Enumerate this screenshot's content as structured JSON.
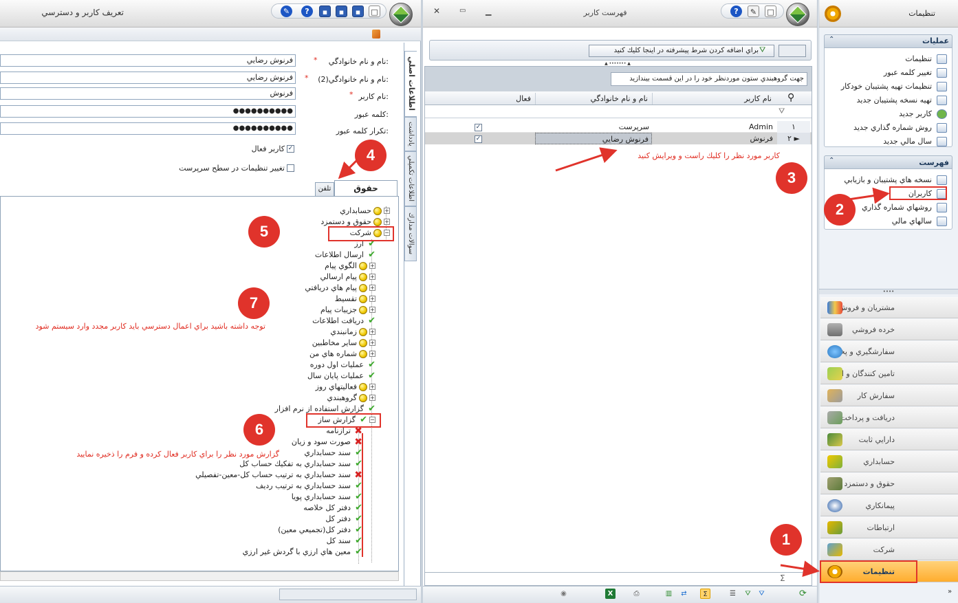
{
  "settings_panel": {
    "title": "تنظيمات",
    "operations_header": "عمليات",
    "operations": [
      "تنظيمات",
      "تغيير كلمه عبور",
      "تنظيمات تهيه پشتيبان خودكار",
      "تهيه نسخه پشتيبان جديد",
      "كاربر جديد",
      "روش شماره گذاري جديد",
      "سال مالي جديد"
    ],
    "list_header": "فهرست",
    "list_items": [
      "نسخه هاي پشتيبان و بازيابي",
      "كاربران",
      "روشهاي شماره گذاري",
      "سالهاي مالي"
    ],
    "nav_modules": [
      "مشتريان و فروش",
      "خرده فروشي",
      "سفارشگيري و پخش",
      "تامين كنندگان و انبار",
      "سفارش كار",
      "دريافت و پرداخت",
      "دارايي ثابت",
      "حسابداري",
      "حقوق و دستمزد",
      "پيمانكاري",
      "ارتباطات",
      "شركت",
      "تنظيمات"
    ],
    "selected_module": "تنظيمات"
  },
  "user_list": {
    "title": "فهرست كاربر",
    "filter_button": "براي اضافه كردن شرط پيشرفته در اينجا كليك كنيد",
    "group_hint": "جهت گروهبندي ستون موردنظر خود را در اين قسمت بيندازيد",
    "columns": [
      "نام كاربر",
      "نام و نام خانوادگي",
      "فعال"
    ],
    "rows": [
      {
        "index": "١",
        "username": "Admin",
        "fullname": "سرپرست",
        "active": true
      },
      {
        "index": "٢",
        "username": "فرنوش",
        "fullname": "فرنوش رضايي",
        "active": true
      }
    ],
    "sigma": "Σ"
  },
  "user_form": {
    "title": "تعريف كاربر و دسترسي",
    "labels": {
      "name": "نام و نام خانوادگي:",
      "name2": "نام و نام خانوادگي(2):",
      "username": "نام كاربر:",
      "password": "كلمه عبور:",
      "password_repeat": "تكرار كلمه عبور:",
      "active": "كاربر فعال",
      "change_settings": "تغيير تنظيمات در سطح سرپرست"
    },
    "values": {
      "name": "فرنوش رضايي",
      "name2": "فرنوش رضايي",
      "username": "فرنوش",
      "password": "●●●●●●●●●●",
      "password_repeat": "●●●●●●●●●●"
    },
    "vertical_tabs": [
      "اطلاعات اصلي",
      "يادداشت",
      "اطلاعات تكميلي",
      "سوالات مدارك"
    ],
    "tabs": [
      "حقوق دسترسي",
      "تلفن"
    ],
    "tree": [
      {
        "label": "حسابداري",
        "icon": "yellow",
        "exp": "+"
      },
      {
        "label": "حقوق و دستمزد",
        "icon": "yellow",
        "exp": "+"
      },
      {
        "label": "شركت",
        "icon": "yellow",
        "exp": "-"
      },
      {
        "label": "ارز",
        "icon": "ok",
        "exp": ""
      },
      {
        "label": "ارسال اطلاعات",
        "icon": "ok",
        "exp": ""
      },
      {
        "label": "الگوي پيام",
        "icon": "yellow",
        "exp": "+"
      },
      {
        "label": "پيام ارسالي",
        "icon": "yellow",
        "exp": "+"
      },
      {
        "label": "پيام هاي دريافتي",
        "icon": "yellow",
        "exp": "+"
      },
      {
        "label": "تقسيط",
        "icon": "yellow",
        "exp": "+"
      },
      {
        "label": "جزييات پيام",
        "icon": "yellow",
        "exp": "+"
      },
      {
        "label": "دريافت اطلاعات",
        "icon": "ok",
        "exp": ""
      },
      {
        "label": "زمانبندي",
        "icon": "yellow",
        "exp": "+"
      },
      {
        "label": "ساير مخاطبين",
        "icon": "yellow",
        "exp": "+"
      },
      {
        "label": "شماره هاي من",
        "icon": "yellow",
        "exp": "+"
      },
      {
        "label": "عمليات اول دوره",
        "icon": "ok",
        "exp": ""
      },
      {
        "label": "عمليات پايان سال",
        "icon": "ok",
        "exp": ""
      },
      {
        "label": "فعاليتهاي روز",
        "icon": "yellow",
        "exp": "+"
      },
      {
        "label": "گروهبندي",
        "icon": "yellow",
        "exp": "+"
      },
      {
        "label": "گزارش استفاده از نرم افزار",
        "icon": "ok",
        "exp": ""
      },
      {
        "label": "گزارش ساز",
        "icon": "ok",
        "exp": "-"
      },
      {
        "label": "ترازنامه",
        "icon": "x",
        "exp": ""
      },
      {
        "label": "صورت سود و زيان",
        "icon": "x",
        "exp": ""
      },
      {
        "label": "سند حسابداري",
        "icon": "ok",
        "exp": ""
      },
      {
        "label": "سند حسابداري به تفكيك حساب كل",
        "icon": "ok",
        "exp": ""
      },
      {
        "label": "سند حسابداري به ترتيب حساب كل-معين-تفصيلي",
        "icon": "x",
        "exp": ""
      },
      {
        "label": "سند حسابداري به ترتيب رديف",
        "icon": "ok",
        "exp": ""
      },
      {
        "label": "سند حسابداري پويا",
        "icon": "ok",
        "exp": ""
      },
      {
        "label": "دفتر كل خلاصه",
        "icon": "ok",
        "exp": ""
      },
      {
        "label": "دفتر كل",
        "icon": "ok",
        "exp": ""
      },
      {
        "label": "دفتر كل(تجميعي معين)",
        "icon": "ok",
        "exp": ""
      },
      {
        "label": "سند كل",
        "icon": "ok",
        "exp": ""
      },
      {
        "label": "معين هاي ارزي با گردش غير ارزي",
        "icon": "ok",
        "exp": ""
      }
    ]
  },
  "annotations": {
    "badges": [
      "1",
      "2",
      "3",
      "4",
      "5",
      "6",
      "7"
    ],
    "note_edit": "كاربر مورد نظر را كليك راست و ويرايش كنيد",
    "note_report": "گزارش مورد نظر را براي كاربر فعال كرده و فرم را ذخيره نماييد",
    "note_relogin": "توجه داشته باشيد براي اعمال دسترسي بايد كاربر مجدد وارد سيستم شود"
  },
  "colors": {
    "annotation_red": "#e0332b",
    "selected_nav": "#ffb733",
    "header_blue": "#1f3b5c"
  }
}
